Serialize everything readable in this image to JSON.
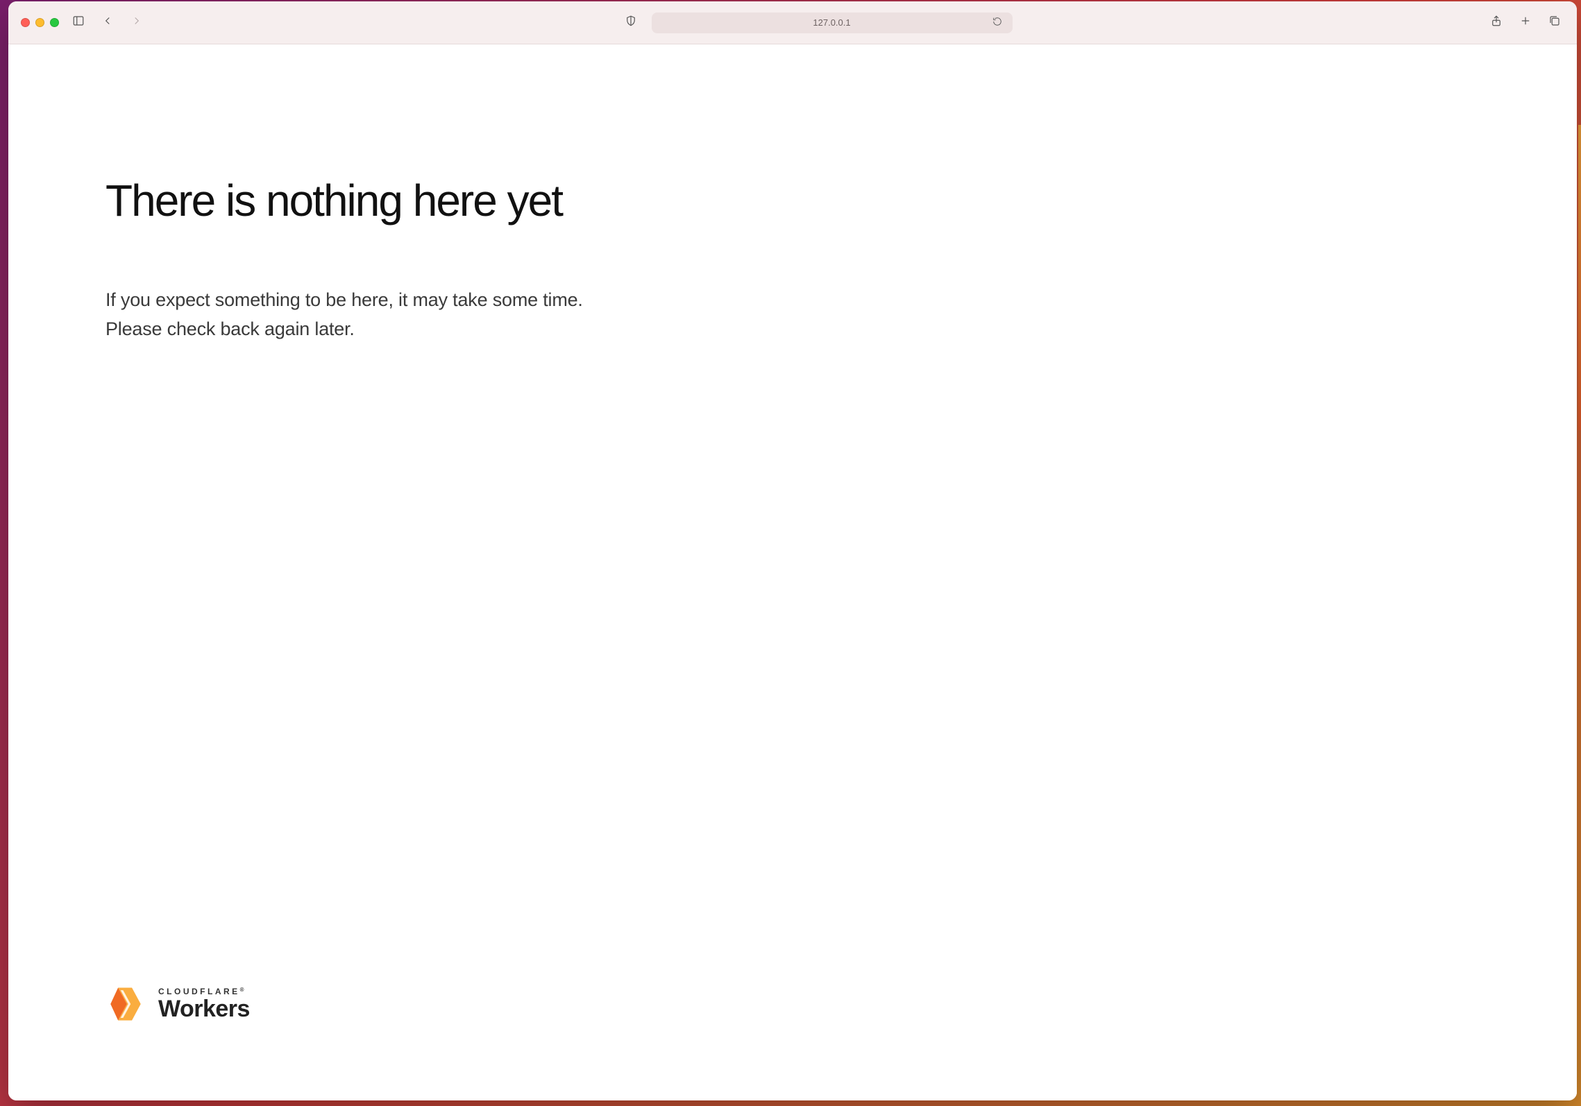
{
  "browser": {
    "address": "127.0.0.1",
    "icons": {
      "sidebar": "sidebar-icon",
      "back": "chevron-left-icon",
      "forward": "chevron-right-icon",
      "privacy": "shield-icon",
      "reload": "reload-icon",
      "share": "share-icon",
      "new_tab": "plus-icon",
      "tabs": "tabs-overview-icon"
    }
  },
  "page": {
    "headline": "There is nothing here yet",
    "paragraph_line1": "If you expect something to be here, it may take some time.",
    "paragraph_line2": "Please check back again later."
  },
  "brand": {
    "overline": "CLOUDFLARE",
    "registered": "®",
    "name": "Workers",
    "logo_colors": {
      "light": "#faad3f",
      "dark": "#f06a23"
    }
  }
}
